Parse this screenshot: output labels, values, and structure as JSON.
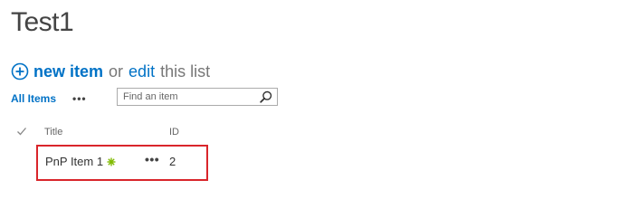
{
  "page": {
    "title": "Test1"
  },
  "command": {
    "new_item_label": "new item",
    "or_text": "or",
    "edit_label": "edit",
    "this_list_text": "this list"
  },
  "view": {
    "all_items_label": "All Items",
    "more_label": "•••"
  },
  "search": {
    "placeholder": "Find an item",
    "value": ""
  },
  "list": {
    "columns": {
      "title": "Title",
      "id": "ID"
    },
    "rows": [
      {
        "title": "PnP Item 1",
        "more_label": "•••",
        "id": "2",
        "is_new": true
      }
    ]
  },
  "icons": {
    "add": "plus-circle-icon",
    "search": "search-icon",
    "select_all": "checkmark-icon",
    "new_badge": "new-badge-icon"
  },
  "colors": {
    "link_blue": "#0072c6",
    "highlight_red": "#d9252b",
    "new_badge_green": "#7fba00"
  }
}
